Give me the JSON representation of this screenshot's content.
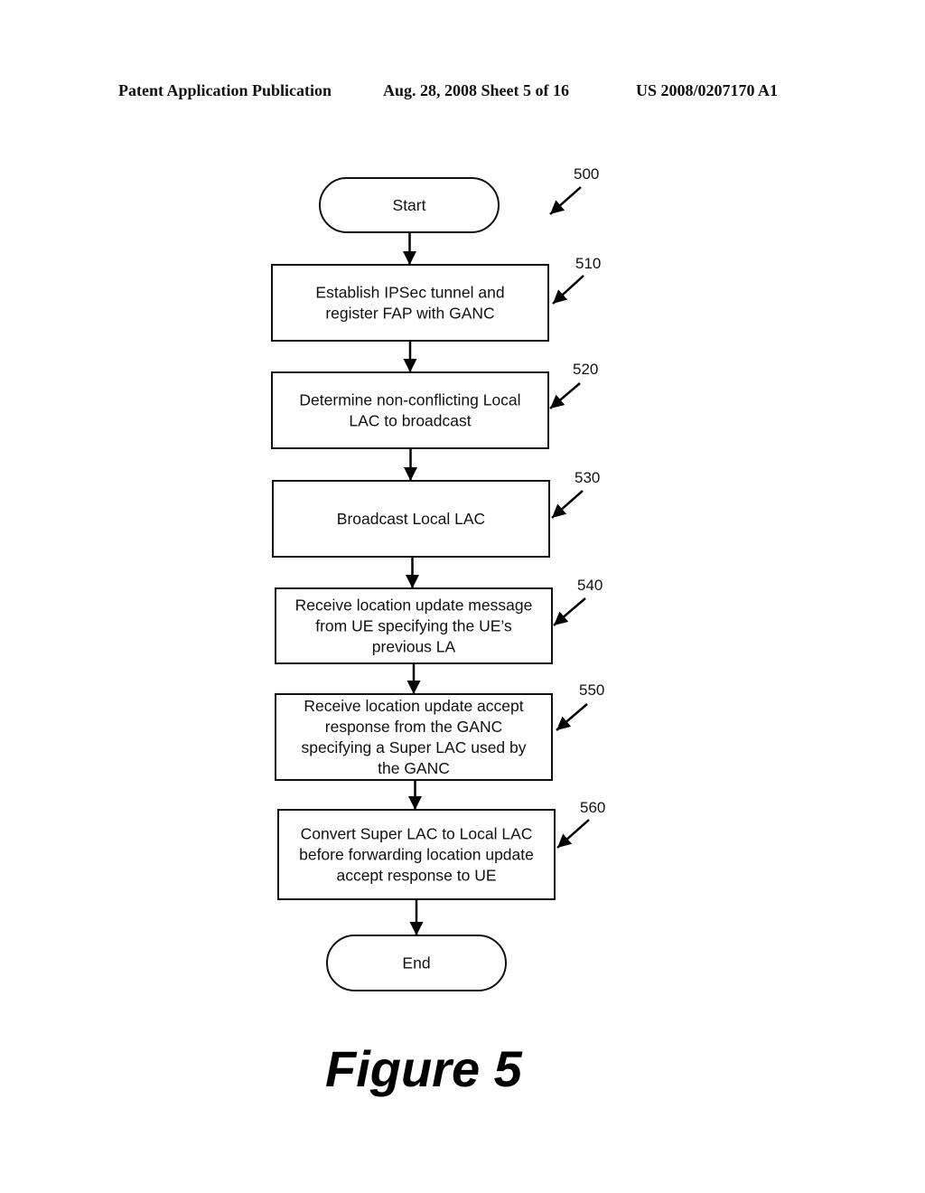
{
  "header": {
    "left": "Patent Application Publication",
    "center": "Aug. 28, 2008  Sheet 5 of 16",
    "right": "US 2008/0207170 A1"
  },
  "figure": {
    "ref": "500",
    "title": "Figure 5"
  },
  "nodes": [
    {
      "id": "start",
      "type": "terminal",
      "ref": "",
      "lines": [
        "Start"
      ]
    },
    {
      "id": "510",
      "type": "process",
      "ref": "510",
      "lines": [
        "Establish IPSec tunnel and",
        "register FAP with GANC"
      ]
    },
    {
      "id": "520",
      "type": "process",
      "ref": "520",
      "lines": [
        "Determine non-conflicting Local",
        "LAC to broadcast"
      ]
    },
    {
      "id": "530",
      "type": "process",
      "ref": "530",
      "lines": [
        "Broadcast Local LAC"
      ]
    },
    {
      "id": "540",
      "type": "process",
      "ref": "540",
      "lines": [
        "Receive location update message",
        "from UE specifying the UE’s",
        "previous LA"
      ]
    },
    {
      "id": "550",
      "type": "process",
      "ref": "550",
      "lines": [
        "Receive location update accept",
        "response from the GANC",
        "specifying a Super LAC used by",
        "the GANC"
      ]
    },
    {
      "id": "560",
      "type": "process",
      "ref": "560",
      "lines": [
        "Convert Super LAC to Local LAC",
        "before forwarding location update",
        "accept response to UE"
      ]
    },
    {
      "id": "end",
      "type": "terminal",
      "ref": "",
      "lines": [
        "End"
      ]
    }
  ],
  "edges": [
    {
      "from": "start",
      "to": "510"
    },
    {
      "from": "510",
      "to": "520"
    },
    {
      "from": "520",
      "to": "530"
    },
    {
      "from": "530",
      "to": "540"
    },
    {
      "from": "540",
      "to": "550"
    },
    {
      "from": "550",
      "to": "560"
    },
    {
      "from": "560",
      "to": "end"
    }
  ]
}
